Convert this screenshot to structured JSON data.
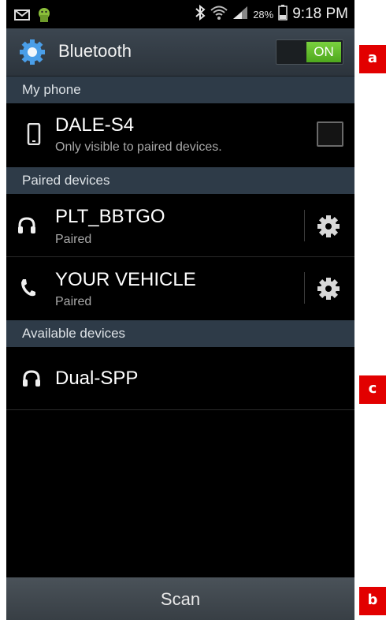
{
  "status_bar": {
    "battery_percent": "28%",
    "time": "9:18 PM"
  },
  "action_bar": {
    "title": "Bluetooth",
    "toggle_label": "ON"
  },
  "sections": {
    "my_phone": "My phone",
    "paired": "Paired devices",
    "available": "Available devices"
  },
  "my_phone": {
    "name": "DALE-S4",
    "subtitle": "Only visible to paired devices."
  },
  "paired_devices": [
    {
      "name": "PLT_BBTGO",
      "status": "Paired",
      "icon": "headset-icon"
    },
    {
      "name": "YOUR VEHICLE",
      "status": "Paired",
      "icon": "phone-handset-icon"
    }
  ],
  "available_devices": [
    {
      "name": "Dual-SPP",
      "icon": "headset-icon"
    }
  ],
  "scan_label": "Scan",
  "callouts": {
    "a": "a",
    "b": "b",
    "c": "c"
  },
  "colors": {
    "toggle_on": "#5cb82a",
    "section_bg": "#2e3b48",
    "callout": "#e20000"
  }
}
